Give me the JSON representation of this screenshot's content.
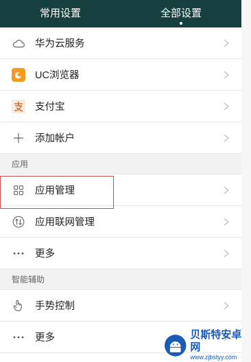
{
  "header": {
    "tabs": [
      {
        "label": "常用设置",
        "active": false
      },
      {
        "label": "全部设置",
        "active": true
      }
    ]
  },
  "accounts": [
    {
      "label": "华为云服务",
      "icon": "cloud-icon"
    },
    {
      "label": "UC浏览器",
      "icon": "uc-browser-icon"
    },
    {
      "label": "支付宝",
      "icon": "alipay-icon"
    },
    {
      "label": "添加帐户",
      "icon": "plus-icon"
    }
  ],
  "sections": {
    "apps": {
      "title": "应用",
      "items": [
        {
          "label": "应用管理",
          "icon": "grid-icon"
        },
        {
          "label": "应用联网管理",
          "icon": "network-icon"
        },
        {
          "label": "更多",
          "icon": "more-icon"
        }
      ]
    },
    "assist": {
      "title": "智能辅助",
      "items": [
        {
          "label": "手势控制",
          "icon": "gesture-icon"
        },
        {
          "label": "更多",
          "icon": "more-icon"
        }
      ]
    }
  },
  "watermark": {
    "title": "贝斯特安卓网",
    "url": "www.zjbstyy.com"
  },
  "colors": {
    "header_bg": "#16403f",
    "highlight_border": "#c0504d",
    "uc_orange": "#f39a1f",
    "watermark_blue": "#1a5bb5"
  }
}
